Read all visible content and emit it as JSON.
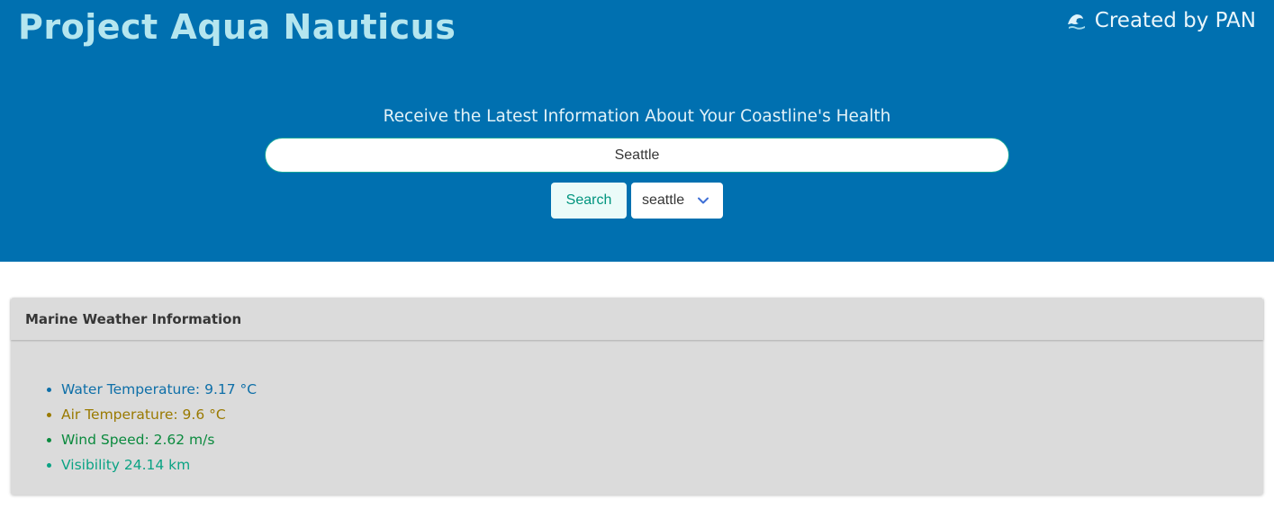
{
  "header": {
    "title": "Project Aqua Nauticus",
    "credit_icon": "wave-icon",
    "credit": "Created by PAN"
  },
  "search": {
    "tagline": "Receive the Latest Information About Your Coastline's Health",
    "value": "Seattle",
    "button_label": "Search",
    "select_value": "seattle"
  },
  "card": {
    "title": "Marine Weather Information",
    "items": [
      {
        "text": "Water Temperature: 9.17 °C",
        "color": "#0e6fa8"
      },
      {
        "text": "Air Temperature: 9.6 °C",
        "color": "#9a7a00"
      },
      {
        "text": "Wind Speed: 2.62 m/s",
        "color": "#0b8a3e"
      },
      {
        "text": "Visibility 24.14 km",
        "color": "#0aa384"
      }
    ]
  },
  "colors": {
    "hero_bg": "#0070b0",
    "title_color": "#b5e6ef",
    "input_border": "#16a69a",
    "button_text": "#00947e",
    "chevron": "#3e6fd6"
  }
}
